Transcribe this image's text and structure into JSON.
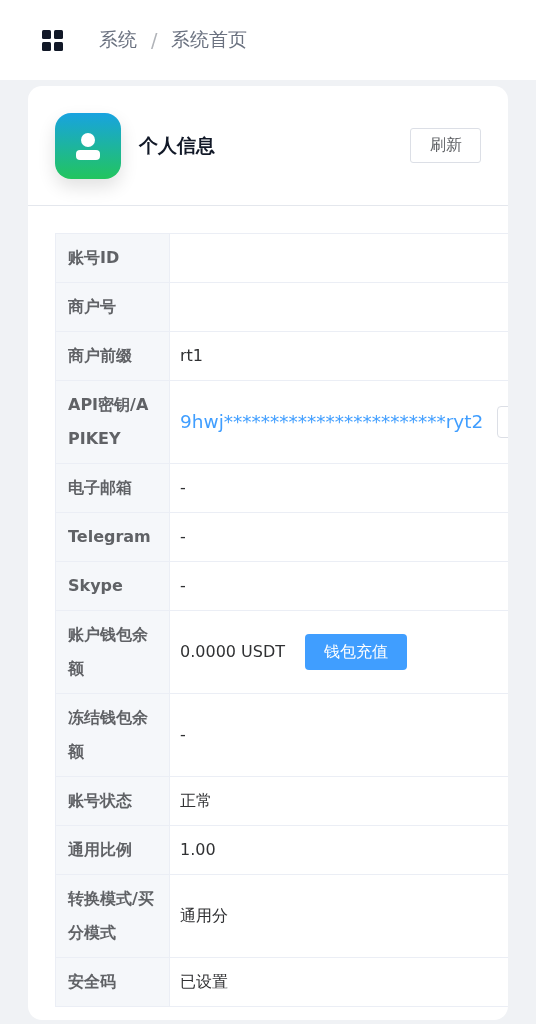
{
  "breadcrumb": [
    "系统",
    "/",
    "系统首页"
  ],
  "card": {
    "title": "个人信息",
    "refresh_button": "刷新"
  },
  "rows": [
    {
      "kind": "text",
      "label": "账号ID"
    },
    {
      "kind": "text",
      "label": "商户号"
    },
    {
      "kind": "text",
      "label": "商户前缀",
      "value": "rt1"
    },
    {
      "kind": "key",
      "label": "API密钥/APIKEY",
      "value": "9hwj************************ryt2"
    },
    {
      "kind": "text",
      "label": "电子邮箱",
      "value": "-"
    },
    {
      "kind": "text",
      "label": "Telegram",
      "value": "-"
    },
    {
      "kind": "text",
      "label": "Skype",
      "value": "-"
    },
    {
      "kind": "balance",
      "label": "账户钱包余额",
      "value": "0.0000 USDT",
      "button": "钱包充值"
    },
    {
      "kind": "text",
      "label": "冻结钱包余额",
      "value": "-"
    },
    {
      "kind": "text",
      "label": "账号状态",
      "value": "正常"
    },
    {
      "kind": "text",
      "label": "通用比例",
      "value": "1.00"
    },
    {
      "kind": "text",
      "label": "转换模式/买分模式",
      "value": "通用分"
    },
    {
      "kind": "text",
      "label": "安全码",
      "value": "已设置"
    }
  ]
}
